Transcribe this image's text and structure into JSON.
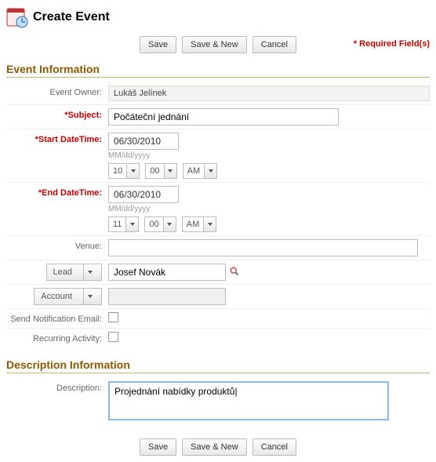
{
  "page_title": "Create Event",
  "toolbar": {
    "save": "Save",
    "save_new": "Save & New",
    "cancel": "Cancel"
  },
  "required_note": "* Required Field(s)",
  "sections": {
    "event_info": "Event Information",
    "desc_info": "Description Information"
  },
  "labels": {
    "event_owner": "Event Owner:",
    "subject": "*Subject:",
    "start_datetime": "*Start DateTime:",
    "end_datetime": "*End DateTime:",
    "venue": "Venue:",
    "lead": "Lead",
    "account": "Account",
    "send_notification": "Send Notification Email:",
    "recurring": "Recurring Activity:",
    "description": "Description:"
  },
  "values": {
    "event_owner": "Lukáš Jelínek",
    "subject": "Počáteční jednání",
    "start_date": "06/30/2010",
    "end_date": "06/30/2010",
    "date_hint": "MM/dd/yyyy",
    "start_hour": "10",
    "start_min": "00",
    "start_ampm": "AM",
    "end_hour": "11",
    "end_min": "00",
    "end_ampm": "AM",
    "venue": "",
    "lead_lookup": "Josef Novák",
    "account_lookup": "",
    "description": "Projednání nabídky produktů|"
  }
}
